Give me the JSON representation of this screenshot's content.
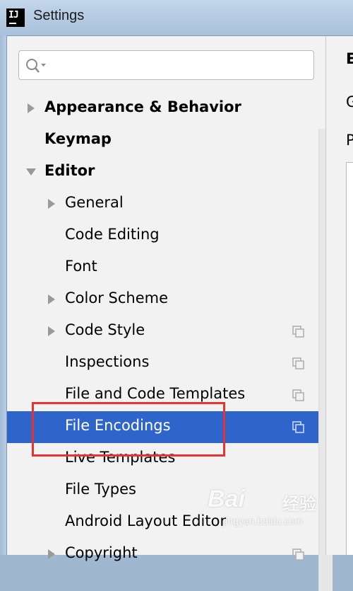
{
  "window": {
    "title": "Settings",
    "app_icon": "IJ"
  },
  "search": {
    "value": "",
    "placeholder": ""
  },
  "tree": [
    {
      "label": "Appearance & Behavior",
      "bold": true,
      "level": 0,
      "arrow": "right",
      "copy": false,
      "selected": false
    },
    {
      "label": "Keymap",
      "bold": true,
      "level": 0,
      "arrow": "none",
      "copy": false,
      "selected": false
    },
    {
      "label": "Editor",
      "bold": true,
      "level": 0,
      "arrow": "down",
      "copy": false,
      "selected": false
    },
    {
      "label": "General",
      "bold": false,
      "level": 1,
      "arrow": "right",
      "copy": false,
      "selected": false
    },
    {
      "label": "Code Editing",
      "bold": false,
      "level": 1,
      "arrow": "none",
      "copy": false,
      "selected": false
    },
    {
      "label": "Font",
      "bold": false,
      "level": 1,
      "arrow": "none",
      "copy": false,
      "selected": false
    },
    {
      "label": "Color Scheme",
      "bold": false,
      "level": 1,
      "arrow": "right",
      "copy": false,
      "selected": false
    },
    {
      "label": "Code Style",
      "bold": false,
      "level": 1,
      "arrow": "right",
      "copy": true,
      "selected": false
    },
    {
      "label": "Inspections",
      "bold": false,
      "level": 1,
      "arrow": "none",
      "copy": true,
      "selected": false
    },
    {
      "label": "File and Code Templates",
      "bold": false,
      "level": 1,
      "arrow": "none",
      "copy": true,
      "selected": false
    },
    {
      "label": "File Encodings",
      "bold": false,
      "level": 1,
      "arrow": "none",
      "copy": true,
      "selected": true
    },
    {
      "label": "Live Templates",
      "bold": false,
      "level": 1,
      "arrow": "none",
      "copy": false,
      "selected": false
    },
    {
      "label": "File Types",
      "bold": false,
      "level": 1,
      "arrow": "none",
      "copy": false,
      "selected": false
    },
    {
      "label": "Android Layout Editor",
      "bold": false,
      "level": 1,
      "arrow": "none",
      "copy": false,
      "selected": false
    },
    {
      "label": "Copyright",
      "bold": false,
      "level": 1,
      "arrow": "right",
      "copy": true,
      "selected": false
    }
  ],
  "right_panel": {
    "heading": "E",
    "line1": "G",
    "line2": "P"
  },
  "watermark": {
    "brand": "Bai",
    "cn": "经验",
    "url": "jingyan.baidu.com"
  },
  "colors": {
    "selection": "#2f65ca",
    "highlight": "#e8332f"
  },
  "icons": {
    "search": "search-icon",
    "expand": "triangle-right-icon",
    "collapse": "triangle-down-icon",
    "project_copy": "copy-icon"
  }
}
